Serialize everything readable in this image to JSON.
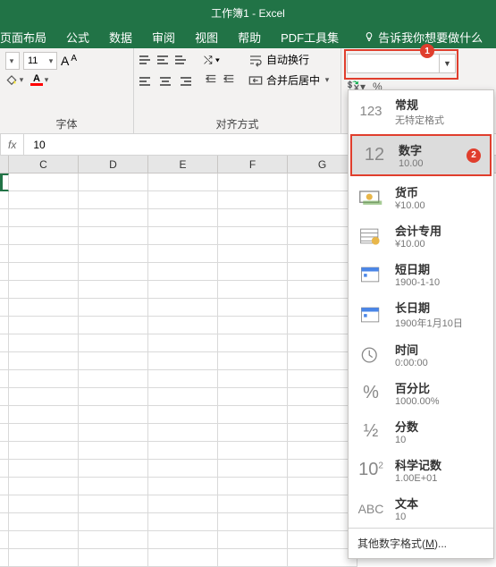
{
  "title": "工作簿1 - Excel",
  "tabs": [
    "页面布局",
    "公式",
    "数据",
    "审阅",
    "视图",
    "帮助",
    "PDF工具集"
  ],
  "tellme": "告诉我你想要做什么",
  "ribbon": {
    "font_group_label": "字体",
    "align_group_label": "对齐方式",
    "font_size": "11",
    "wrap_label": "自动换行",
    "merge_label": "合并后居中"
  },
  "numfmt": {
    "selected": ""
  },
  "formula": {
    "fx": "fx",
    "value": "10"
  },
  "columns": [
    "C",
    "D",
    "E",
    "F",
    "G"
  ],
  "dropdown": {
    "items": [
      {
        "icon": "123",
        "title": "常规",
        "sub": "无特定格式"
      },
      {
        "icon": "12",
        "title": "数字",
        "sub": "10.00"
      },
      {
        "icon": "curr",
        "title": "货币",
        "sub": "¥10.00"
      },
      {
        "icon": "acct",
        "title": "会计专用",
        "sub": "¥10.00"
      },
      {
        "icon": "sdate",
        "title": "短日期",
        "sub": "1900-1-10"
      },
      {
        "icon": "ldate",
        "title": "长日期",
        "sub": "1900年1月10日"
      },
      {
        "icon": "time",
        "title": "时间",
        "sub": "0:00:00"
      },
      {
        "icon": "pct",
        "title": "百分比",
        "sub": "1000.00%"
      },
      {
        "icon": "frac",
        "title": "分数",
        "sub": "10"
      },
      {
        "icon": "sci",
        "title": "科学记数",
        "sub": "1.00E+01"
      },
      {
        "icon": "text",
        "title": "文本",
        "sub": "10"
      }
    ],
    "footer_pre": "其他数字格式(",
    "footer_key": "M",
    "footer_post": ")..."
  },
  "badges": {
    "one": "1",
    "two": "2"
  }
}
